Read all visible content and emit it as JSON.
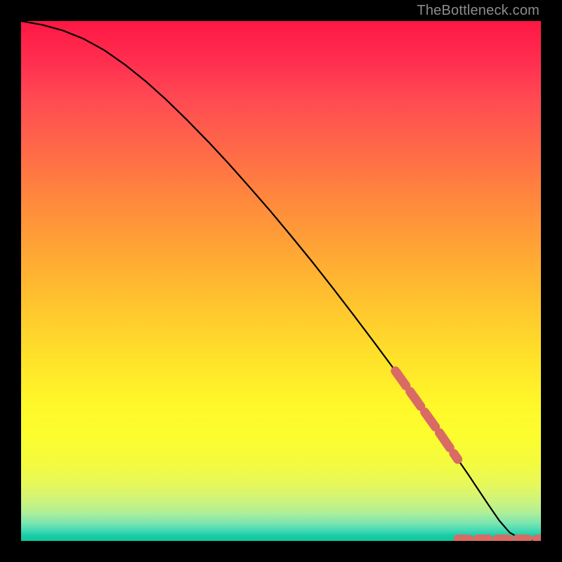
{
  "watermark": "TheBottleneck.com",
  "chart_data": {
    "type": "line",
    "title": "",
    "xlabel": "",
    "ylabel": "",
    "xlim": [
      0,
      100
    ],
    "ylim": [
      0,
      100
    ],
    "series": [
      {
        "name": "curve",
        "style": "solid",
        "color": "#000000",
        "x": [
          0,
          4,
          8,
          12,
          16,
          20,
          24,
          28,
          32,
          36,
          40,
          44,
          48,
          52,
          56,
          60,
          64,
          68,
          72,
          76,
          80,
          82,
          84,
          86,
          88,
          90,
          92,
          94,
          96,
          98,
          100
        ],
        "y": [
          100,
          99.3,
          98.2,
          96.6,
          94.4,
          91.6,
          88.4,
          84.8,
          80.9,
          76.8,
          72.5,
          68.0,
          63.4,
          58.6,
          53.7,
          48.6,
          43.4,
          38.1,
          32.7,
          27.1,
          21.5,
          18.6,
          15.7,
          12.8,
          9.8,
          6.8,
          3.9,
          1.6,
          0.5,
          0.15,
          0.1
        ]
      },
      {
        "name": "highlight-diagonal",
        "style": "thick-dashed",
        "color": "#e06666",
        "x": [
          72,
          74,
          76,
          78,
          80,
          82,
          84
        ],
        "y": [
          32.7,
          29.9,
          27.1,
          24.3,
          21.5,
          18.6,
          15.7
        ]
      },
      {
        "name": "highlight-bottom",
        "style": "thick-dashed",
        "color": "#e06666",
        "x": [
          84,
          86,
          88,
          90,
          92,
          93.5,
          95.5,
          97,
          99,
          100
        ],
        "y": [
          0.4,
          0.4,
          0.4,
          0.4,
          0.4,
          0.4,
          0.4,
          0.4,
          0.4,
          0.4
        ]
      }
    ]
  },
  "colors": {
    "dash": "#da6a64",
    "curve": "#000000"
  }
}
